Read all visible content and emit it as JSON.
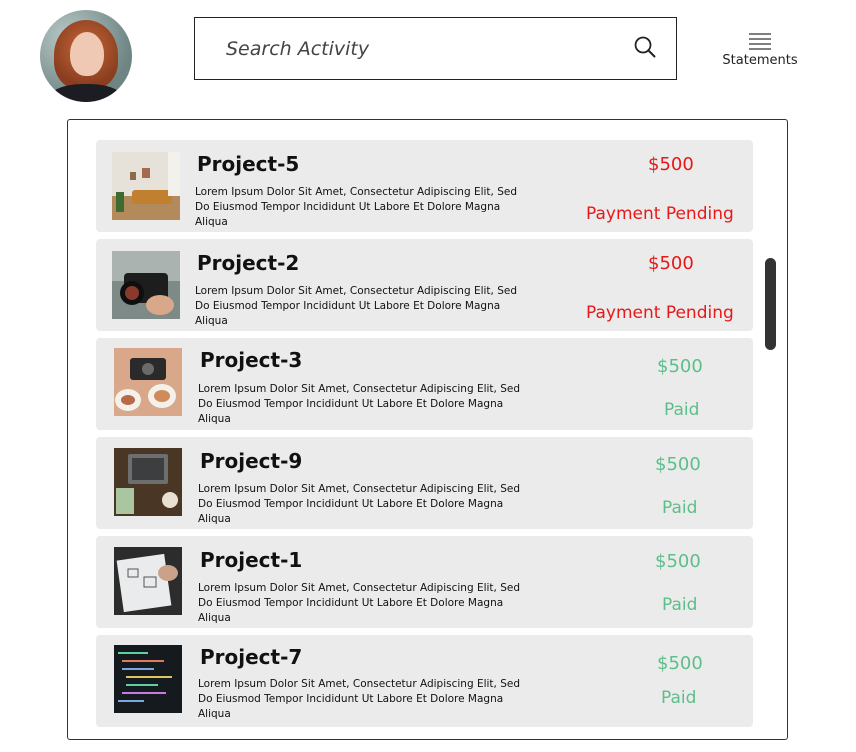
{
  "search": {
    "placeholder": "Search Activity"
  },
  "header": {
    "statements_label": "Statements"
  },
  "colors": {
    "pending": "#e81818",
    "paid": "#5cbf8a",
    "card_bg": "#ebebeb"
  },
  "projects": [
    {
      "title": "Project-5",
      "description": "Lorem Ipsum Dolor Sit Amet, Consectetur Adipiscing Elit, Sed Do Eiusmod Tempor Incididunt Ut Labore Et Dolore Magna Aliqua",
      "amount": "$500",
      "status": "Payment Pending",
      "image": "living-room-photo"
    },
    {
      "title": "Project-2",
      "description": "Lorem Ipsum Dolor Sit Amet, Consectetur Adipiscing Elit, Sed Do Eiusmod Tempor Incididunt Ut Labore Et Dolore Magna Aliqua",
      "amount": "$500",
      "status": "Payment Pending",
      "image": "camera-photo"
    },
    {
      "title": "Project-3",
      "description": "Lorem Ipsum Dolor Sit Amet, Consectetur Adipiscing Elit, Sed Do Eiusmod Tempor Incididunt Ut Labore Et Dolore Magna Aliqua",
      "amount": "$500",
      "status": "Paid",
      "image": "food-photo"
    },
    {
      "title": "Project-9",
      "description": "Lorem Ipsum Dolor Sit Amet, Consectetur Adipiscing Elit, Sed Do Eiusmod Tempor Incididunt Ut Labore Et Dolore Magna Aliqua",
      "amount": "$500",
      "status": "Paid",
      "image": "laptop-photo"
    },
    {
      "title": "Project-1",
      "description": "Lorem Ipsum Dolor Sit Amet, Consectetur Adipiscing Elit, Sed Do Eiusmod Tempor Incididunt Ut Labore Et Dolore Magna Aliqua",
      "amount": "$500",
      "status": "Paid",
      "image": "sketching-photo"
    },
    {
      "title": "Project-7",
      "description": "Lorem Ipsum Dolor Sit Amet, Consectetur Adipiscing Elit, Sed Do Eiusmod Tempor Incididunt Ut Labore Et Dolore Magna Aliqua",
      "amount": "$500",
      "status": "Paid",
      "image": "code-photo"
    }
  ]
}
